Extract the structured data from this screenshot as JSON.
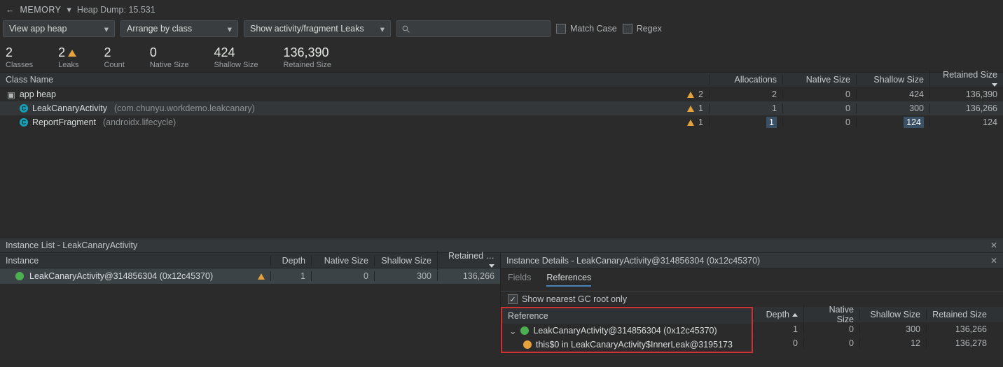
{
  "top": {
    "back": "←",
    "mem": "MEMORY",
    "heap_dump": "Heap Dump: 15.531"
  },
  "filters": {
    "view_heap": "View app heap",
    "arrange": "Arrange by class",
    "show_leaks": "Show activity/fragment Leaks",
    "match_case": "Match Case",
    "regex": "Regex",
    "search_placeholder": ""
  },
  "stats": [
    {
      "num": "2",
      "lbl": "Classes"
    },
    {
      "num": "2",
      "lbl": "Leaks",
      "warn": true
    },
    {
      "num": "2",
      "lbl": "Count"
    },
    {
      "num": "0",
      "lbl": "Native Size"
    },
    {
      "num": "424",
      "lbl": "Shallow Size"
    },
    {
      "num": "136,390",
      "lbl": "Retained Size"
    }
  ],
  "cols": {
    "classname": "Class Name",
    "alloc": "Allocations",
    "native": "Native Size",
    "shallow": "Shallow Size",
    "retained": "Retained Size"
  },
  "rows": [
    {
      "kind": "heap",
      "name": "app heap",
      "warn_n": "2",
      "alloc": "2",
      "native": "0",
      "shallow": "424",
      "retained": "136,390"
    },
    {
      "kind": "leak",
      "name": "LeakCanaryActivity",
      "pkg": "(com.chunyu.workdemo.leakcanary)",
      "warn_n": "1",
      "alloc": "1",
      "native": "0",
      "shallow": "300",
      "retained": "136,266"
    },
    {
      "kind": "item",
      "name": "ReportFragment",
      "pkg": "(androidx.lifecycle)",
      "warn_n": "1",
      "alloc": "1",
      "native": "0",
      "shallow": "124",
      "retained": "124",
      "sel_alloc": true,
      "sel_shallow": true
    }
  ],
  "instance_list": {
    "title": "Instance List - LeakCanaryActivity",
    "cols": {
      "instance": "Instance",
      "depth": "Depth",
      "native": "Native Size",
      "shallow": "Shallow Size",
      "retained": "Retained …"
    },
    "rows": [
      {
        "name": "LeakCanaryActivity@314856304 (0x12c45370)",
        "depth": "1",
        "native": "0",
        "shallow": "300",
        "retained": "136,266",
        "warn": true
      }
    ]
  },
  "details": {
    "title": "Instance Details - LeakCanaryActivity@314856304 (0x12c45370)",
    "tabs": {
      "fields": "Fields",
      "references": "References"
    },
    "gc_root": "Show nearest GC root only",
    "ref_col": "Reference",
    "cols": {
      "depth": "Depth",
      "native": "Native Size",
      "shallow": "Shallow Size",
      "retained": "Retained Size"
    },
    "rows": [
      {
        "kind": "green",
        "name": "LeakCanaryActivity@314856304 (0x12c45370)",
        "depth": "1",
        "native": "0",
        "shallow": "300",
        "retained": "136,266"
      },
      {
        "kind": "yellow",
        "name": "this$0 in LeakCanaryActivity$InnerLeak@3195173",
        "depth": "0",
        "native": "0",
        "shallow": "12",
        "retained": "136,278"
      }
    ]
  }
}
